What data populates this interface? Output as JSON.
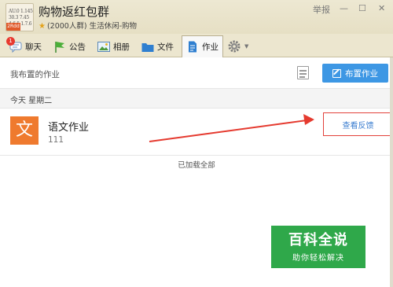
{
  "window": {
    "group_name": "购物返红包群",
    "meta": "(2000人群) 生活休闲-购物",
    "report_label": "举报",
    "minimize_glyph": "—",
    "maximize_glyph": "☐",
    "close_glyph": "✕",
    "avatar_text": "AU.0 1.145\n30.3 7.45\n4.6.5 1.7.6",
    "avatar_tag": "2Rdd"
  },
  "tabs": [
    {
      "label": "聊天",
      "badge": "1"
    },
    {
      "label": "公告"
    },
    {
      "label": "相册"
    },
    {
      "label": "文件"
    },
    {
      "label": "作业"
    }
  ],
  "homework": {
    "header_title": "我布置的作业",
    "assign_button": "布置作业",
    "date_label": "今天  星期二",
    "items": [
      {
        "icon_char": "文",
        "title": "语文作业",
        "subtitle": "111",
        "action": "查看反馈"
      }
    ],
    "loaded_text": "已加载全部"
  },
  "watermark": {
    "main": "百科全说",
    "sub": "助你轻松解决"
  },
  "colors": {
    "accent_blue": "#3d97e4",
    "highlight_red": "#e2413a",
    "subject_orange": "#ef7a2e",
    "watermark_green": "#2fa84a"
  }
}
